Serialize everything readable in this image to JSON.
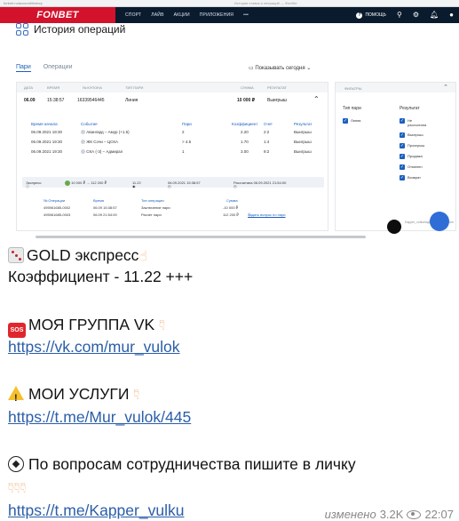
{
  "browser": {
    "url": "fonbet.ru/account/history",
    "title": "История ставок и операций — Фонбет"
  },
  "brand": {
    "logo": "FONBET",
    "accent": "#d3122b",
    "nav_bg": "#0a1b2e"
  },
  "nav": {
    "items": [
      "СПОРТ",
      "ЛАЙВ",
      "АКЦИИ",
      "ПРИЛОЖЕНИЯ",
      "•••"
    ],
    "help": "ПОМОЩЬ"
  },
  "page": {
    "title": "История операций",
    "tabs": [
      "Пари",
      "Операции"
    ],
    "show_filter": "Показывать сегодня"
  },
  "table": {
    "headers": [
      "ДАТА",
      "ВРЕМЯ",
      "№ КУПОНА",
      "ТИП ПАРИ",
      "СУММА",
      "РЕЗУЛЬТАТ"
    ],
    "row": {
      "date": "06.09",
      "time": "15:38:57",
      "coupon": "16339546445",
      "type": "Линия",
      "sum": "10 000 ₽",
      "result": "Выигрыш"
    }
  },
  "details": {
    "headers": [
      "Время начала",
      "Событие",
      "Пари",
      "Коэффициент",
      "Счет",
      "Результат"
    ],
    "rows": [
      {
        "start": "06.09.2021 19:30",
        "event": "Авангард – Амур (+1.5)",
        "bet": "2",
        "coef": "2.20",
        "score": "2:2",
        "result": "Выигрыш"
      },
      {
        "start": "06.09.2021 19:30",
        "event": "ЖК Сочи – ЦСКА",
        "bet": "> 4.5",
        "coef": "1.70",
        "score": "1:4",
        "result": "Выигрыш"
      },
      {
        "start": "06.09.2021 19:30",
        "event": "СКА (-3) – Адмирал",
        "bet": "1",
        "coef": "3.00",
        "score": "9:2",
        "result": "Выигрыш"
      }
    ]
  },
  "summary": {
    "type": "Экспресс:",
    "amount": "10 000 ₽ → 112 200 ₽",
    "coef": "11.22",
    "placed": "06.09.2021 15:38:57",
    "settled": "Рассчитана 06.09.2021 21:54:00"
  },
  "operations": {
    "headers": [
      "№ Операции",
      "Время",
      "Тип операции",
      "Сумма"
    ],
    "rows": [
      {
        "id": "495961685-0002",
        "time": "06.09 15:38:57",
        "type": "Заключение пари",
        "sum": "-10 000 ₽"
      },
      {
        "id": "495961685-0003",
        "time": "06.09 21:54:00",
        "type": "Расчет пари",
        "sum": "112 200 ₽"
      }
    ],
    "question_link": "Задать вопрос по пари"
  },
  "filters": {
    "header": "ФИЛЬТРЫ",
    "bet_type_title": "Тип пари",
    "bet_types": [
      "Линия"
    ],
    "result_title": "Результат",
    "results": [
      "Не рассчитана",
      "Выигрыш",
      "Проигрыш",
      "Продажа",
      "Отменен",
      "Возврат"
    ]
  },
  "avatar_caption": "Kapper_vulkuNaДжерелоTelegram",
  "message": {
    "line1_title": "GOLD экспресс",
    "line2": "Коэффициент - 11.22 +++",
    "group_title": "МОЯ ГРУППА VK",
    "group_link": "https://vk.com/mur_vulok",
    "services_title": "МОИ УСЛУГИ",
    "services_link": "https://t.me/Mur_vulok/445",
    "collab_text": "По вопросам сотрудничества пишите в личку",
    "collab_link": "https://t.me/Kapper_vulku",
    "edited": "изменено",
    "views": "3.2K",
    "time": "22:07"
  }
}
